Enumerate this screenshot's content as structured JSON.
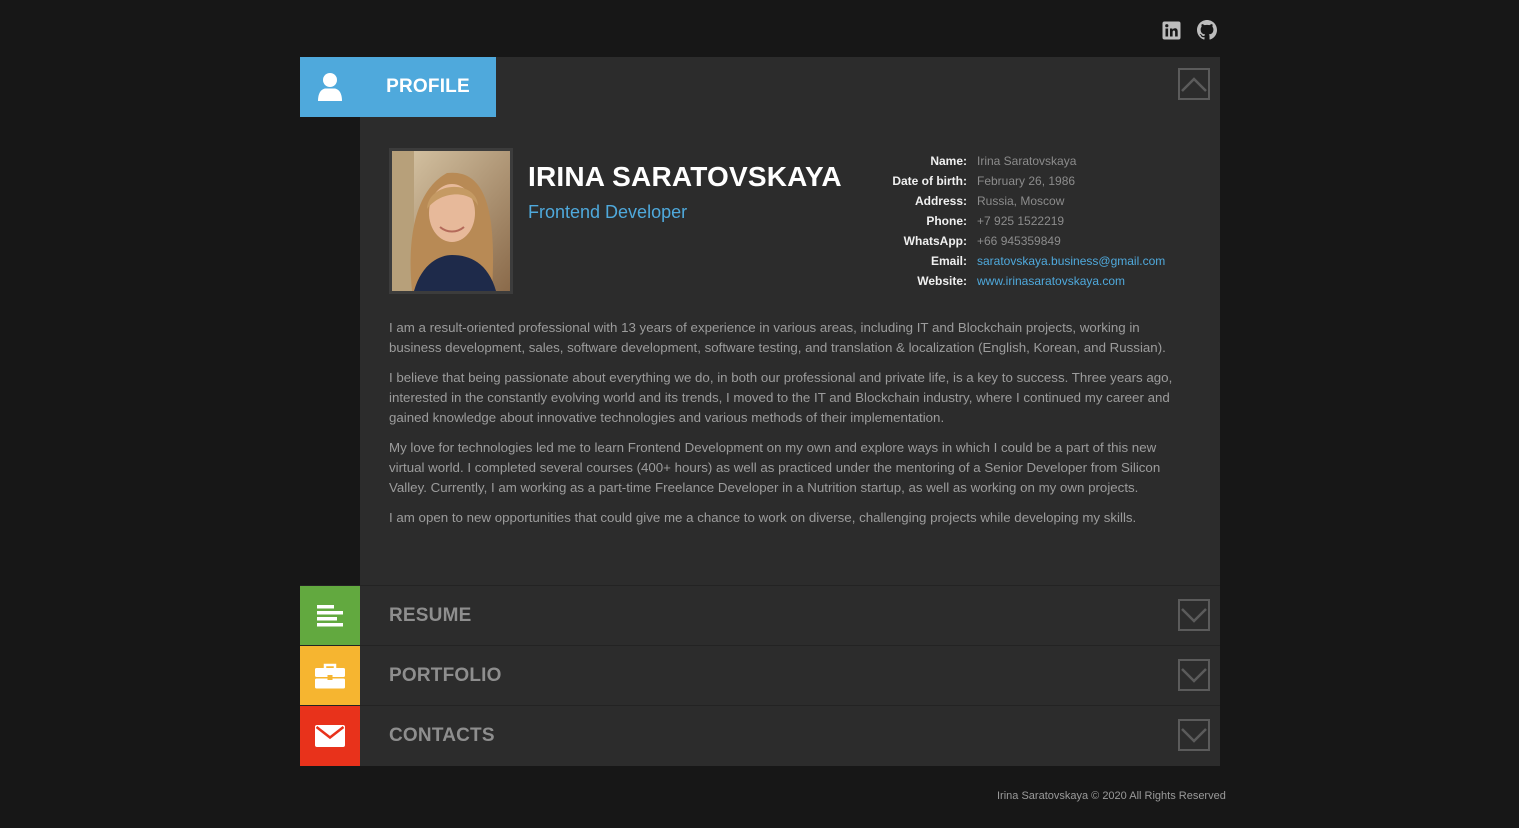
{
  "social": [
    {
      "name": "linkedin-icon"
    },
    {
      "name": "github-icon"
    }
  ],
  "profile": {
    "label": "PROFILE",
    "name": "IRINA SARATOVSKAYA",
    "role": "Frontend Developer",
    "info": [
      {
        "label": "Name:",
        "value": "Irina Saratovskaya",
        "link": false
      },
      {
        "label": "Date of birth:",
        "value": "February 26, 1986",
        "link": false
      },
      {
        "label": "Address:",
        "value": "Russia, Moscow",
        "link": false
      },
      {
        "label": "Phone:",
        "value": "+7 925 1522219",
        "link": false
      },
      {
        "label": "WhatsApp:",
        "value": "+66 945359849",
        "link": false
      },
      {
        "label": "Email:",
        "value": "saratovskaya.business@gmail.com",
        "link": true
      },
      {
        "label": "Website:",
        "value": "www.irinasaratovskaya.com",
        "link": true
      }
    ],
    "bio": [
      "I am a result-oriented professional with 13 years of experience in various areas, including IT and Blockchain projects, working in business development, sales, software development, software testing, and translation & localization (English, Korean, and Russian).",
      "I believe that being passionate about everything we do, in both our professional and private life, is a key to success. Three years ago, interested in the constantly evolving world and its trends, I moved to the IT and Blockchain industry, where I continued my career and gained knowledge about innovative technologies and various methods of their implementation.",
      "My love for technologies led me to learn Frontend Development on my own and explore ways in which I could be a part of this new virtual world. I completed several courses (400+ hours) as well as practiced under the mentoring of a Senior Developer from Silicon Valley. Currently, I am working as a part-time Freelance Developer in a Nutrition startup, as well as working on my own projects.",
      "I am open to new opportunities that could give me a chance to work on diverse, challenging projects while developing my skills."
    ]
  },
  "sections": [
    {
      "title": "RESUME",
      "color": "#62a93f",
      "icon": "resume-icon"
    },
    {
      "title": "PORTFOLIO",
      "color": "#f6b530",
      "icon": "briefcase-icon"
    },
    {
      "title": "CONTACTS",
      "color": "#e8321b",
      "icon": "envelope-icon"
    }
  ],
  "colors": {
    "accent": "#4fa9dc",
    "background": "#171717",
    "panel": "#2c2c2c"
  },
  "footer": "Irina Saratovskaya © 2020 All Rights Reserved"
}
